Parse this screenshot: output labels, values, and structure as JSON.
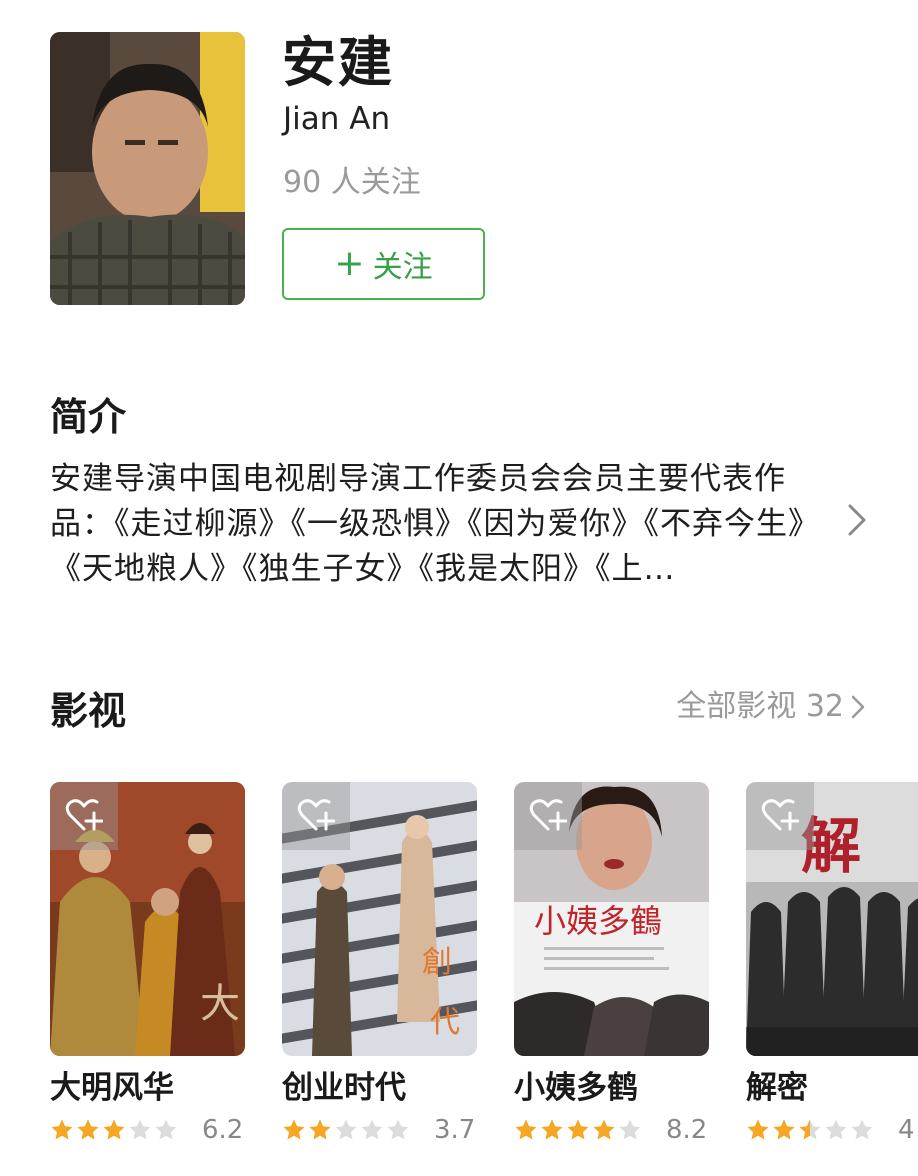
{
  "profile": {
    "name_cn": "安建",
    "name_en": "Jian An",
    "followers": "90 人关注",
    "follow_label": "关注"
  },
  "intro": {
    "title": "简介",
    "text": "安建导演中国电视剧导演工作委员会会员主要代表作品：《走过柳源》《一级恐惧》《因为爱你》《不弃今生》《天地粮人》《独生子女》《我是太阳》《上…"
  },
  "films": {
    "title": "影视",
    "all_label": "全部影视 32",
    "items": [
      {
        "title": "大明风华",
        "stars": 3,
        "score": "6.2"
      },
      {
        "title": "创业时代",
        "stars": 2,
        "score": "3.7"
      },
      {
        "title": "小姨多鹤",
        "stars": 4,
        "score": "8.2"
      },
      {
        "title": "解密",
        "stars": 2.5,
        "score": "4"
      }
    ]
  },
  "colors": {
    "accent_green": "#3aa047",
    "star_gold": "#f5a623",
    "star_empty": "#dcdcdc",
    "muted_text": "#9a9a9a"
  }
}
